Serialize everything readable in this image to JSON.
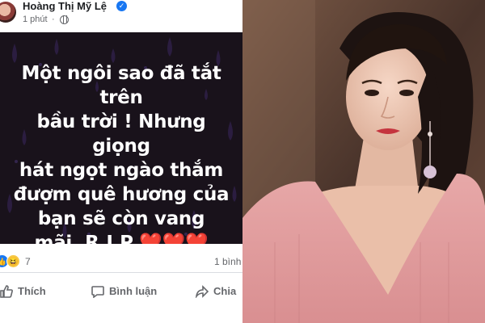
{
  "post": {
    "author": "Hoàng Thị Mỹ Lệ",
    "time": "1 phút",
    "separator": "·",
    "status_lines": [
      "Một ngôi sao đã tắt trên",
      "bầu trời ! Nhưng giọng",
      "hát ngọt ngào thắm",
      "đượm quê hương của",
      "bạn sẽ còn vang",
      "mãi .R.I.P"
    ],
    "hearts": "❤️❤️❤️",
    "reaction_count": "7",
    "comment_count": "1 bình",
    "actions": {
      "like": "Thích",
      "comment": "Bình luận",
      "share": "Chia"
    },
    "card_background": "#19121b",
    "accent": "#1877f2"
  },
  "icons": {
    "verified": "verified-check-icon",
    "globe": "globe-icon",
    "like_reaction": "like-reaction-icon",
    "haha_reaction": "haha-reaction-icon",
    "like_action": "thumbs-up-icon",
    "comment_action": "comment-bubble-icon",
    "share_action": "share-arrow-icon"
  }
}
